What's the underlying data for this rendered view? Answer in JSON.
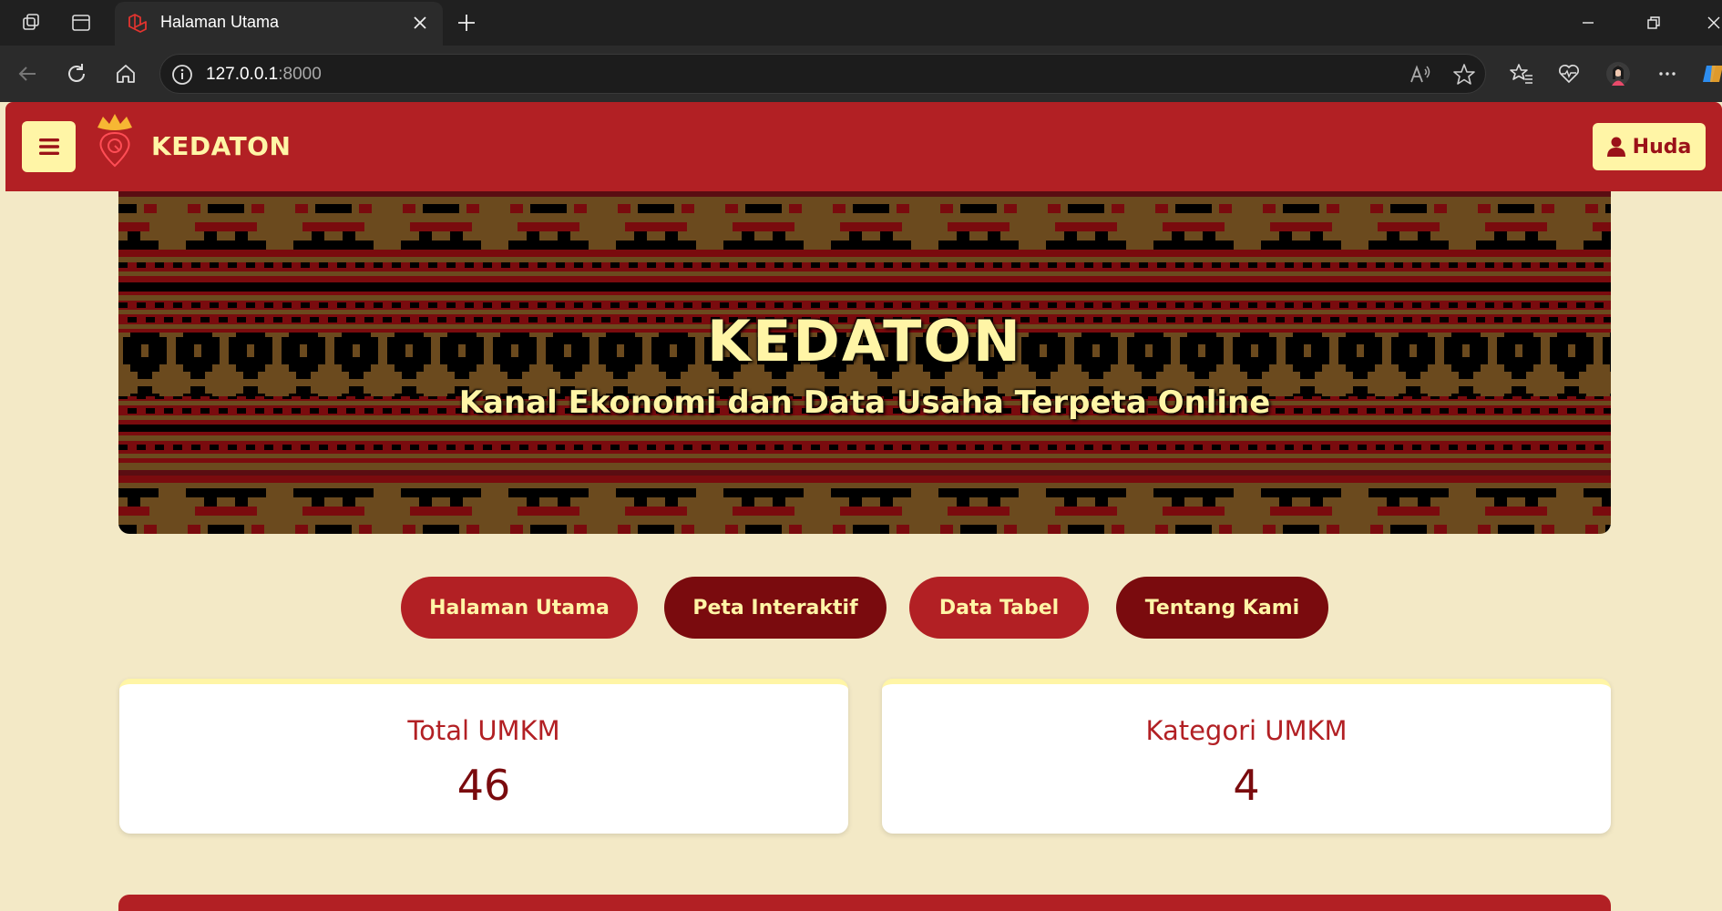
{
  "browser": {
    "tab_title": "Halaman Utama",
    "url_host": "127.0.0.1",
    "url_port": ":8000"
  },
  "header": {
    "brand": "KEDATON",
    "user_name": "Huda"
  },
  "hero": {
    "title": "KEDATON",
    "subtitle": "Kanal Ekonomi dan Data Usaha Terpeta Online"
  },
  "nav": {
    "items": [
      {
        "label": "Halaman Utama"
      },
      {
        "label": "Peta Interaktif"
      },
      {
        "label": "Data Tabel"
      },
      {
        "label": "Tentang Kami"
      }
    ]
  },
  "stats": {
    "cards": [
      {
        "label": "Total UMKM",
        "value": "46"
      },
      {
        "label": "Kategori UMKM",
        "value": "4"
      }
    ]
  },
  "colors": {
    "primary_red": "#b22024",
    "dark_red": "#7a0b0e",
    "cream": "#fff5a6",
    "page_bg": "#f3e9c6"
  }
}
